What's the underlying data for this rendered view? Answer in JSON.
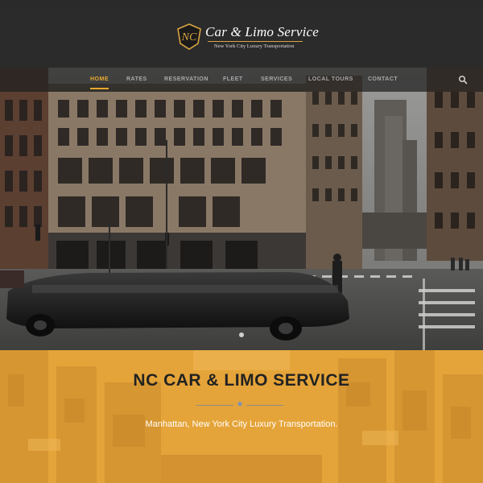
{
  "brand": {
    "title": "Car & Limo Service",
    "tagline": "New York City Luxury Transportation",
    "monogram": "NC",
    "accent_color": "#e8a82e"
  },
  "nav": {
    "items": [
      {
        "label": "HOME",
        "active": true
      },
      {
        "label": "RATES",
        "active": false
      },
      {
        "label": "RESERVATION",
        "active": false
      },
      {
        "label": "FLEET",
        "active": false
      },
      {
        "label": "SERVICES",
        "active": false
      },
      {
        "label": "LOCAL TOURS",
        "active": false
      },
      {
        "label": "CONTACT",
        "active": false
      }
    ],
    "search_icon": "search-icon"
  },
  "hero": {
    "description_icon": "city-street-limousine-photo",
    "slider_dots": 1,
    "active_slide": 1
  },
  "intro": {
    "title": "NC CAR & LIMO SERVICE",
    "subtitle": "Manhattan, New York City Luxury Transportation.",
    "divider_icon": "star-icon",
    "band_color": "#e4a13a"
  }
}
